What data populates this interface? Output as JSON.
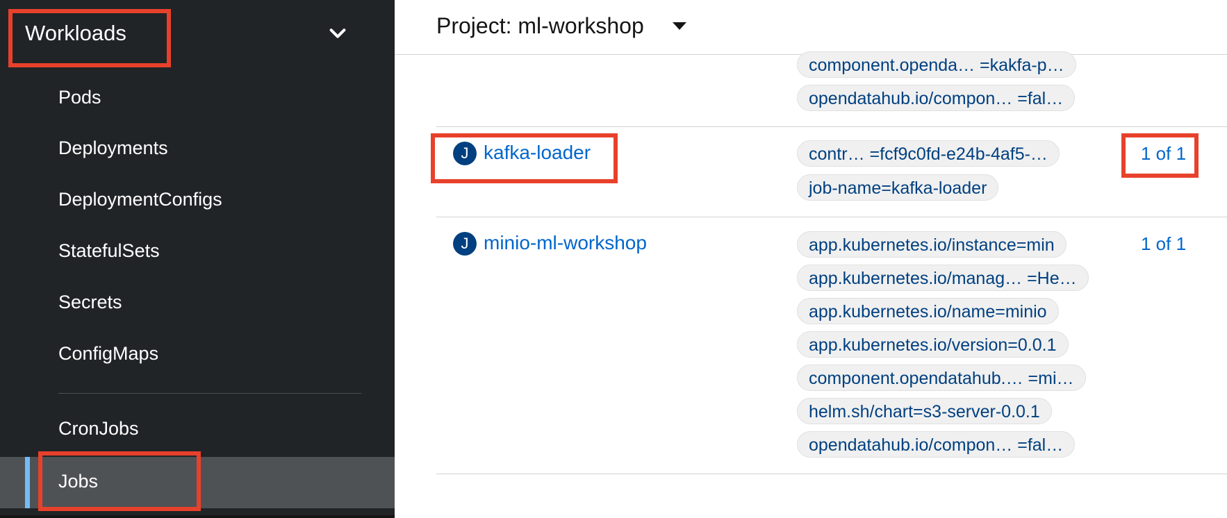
{
  "sidebar": {
    "section_title": "Workloads",
    "items": [
      {
        "label": "Pods"
      },
      {
        "label": "Deployments"
      },
      {
        "label": "DeploymentConfigs"
      },
      {
        "label": "StatefulSets"
      },
      {
        "label": "Secrets"
      },
      {
        "label": "ConfigMaps"
      },
      {
        "label": "CronJobs"
      },
      {
        "label": "Jobs",
        "active": true
      }
    ]
  },
  "header": {
    "project_label": "Project: ml-workshop"
  },
  "rows": [
    {
      "name": "",
      "labels": [
        "component.openda… =kakfa-p…",
        "opendatahub.io/compon…  =fal…"
      ],
      "completions": ""
    },
    {
      "badge": "J",
      "name": "kafka-loader",
      "labels": [
        "contr…  =fcf9c0fd-e24b-4af5-…",
        "job-name=kafka-loader"
      ],
      "completions": "1 of 1"
    },
    {
      "badge": "J",
      "name": "minio-ml-workshop",
      "labels": [
        "app.kubernetes.io/instance=min",
        "app.kubernetes.io/manag… =He…",
        "app.kubernetes.io/name=minio",
        "app.kubernetes.io/version=0.0.1",
        "component.opendatahub.… =mi…",
        "helm.sh/chart=s3-server-0.0.1",
        "opendatahub.io/compon…  =fal…"
      ],
      "completions": "1 of 1"
    }
  ],
  "colors": {
    "sidebar_bg": "#212427",
    "active_bg": "#4f5255",
    "active_accent": "#73bcf7",
    "link": "#0066cc",
    "badge": "#004080",
    "highlight": "#e8412b"
  }
}
